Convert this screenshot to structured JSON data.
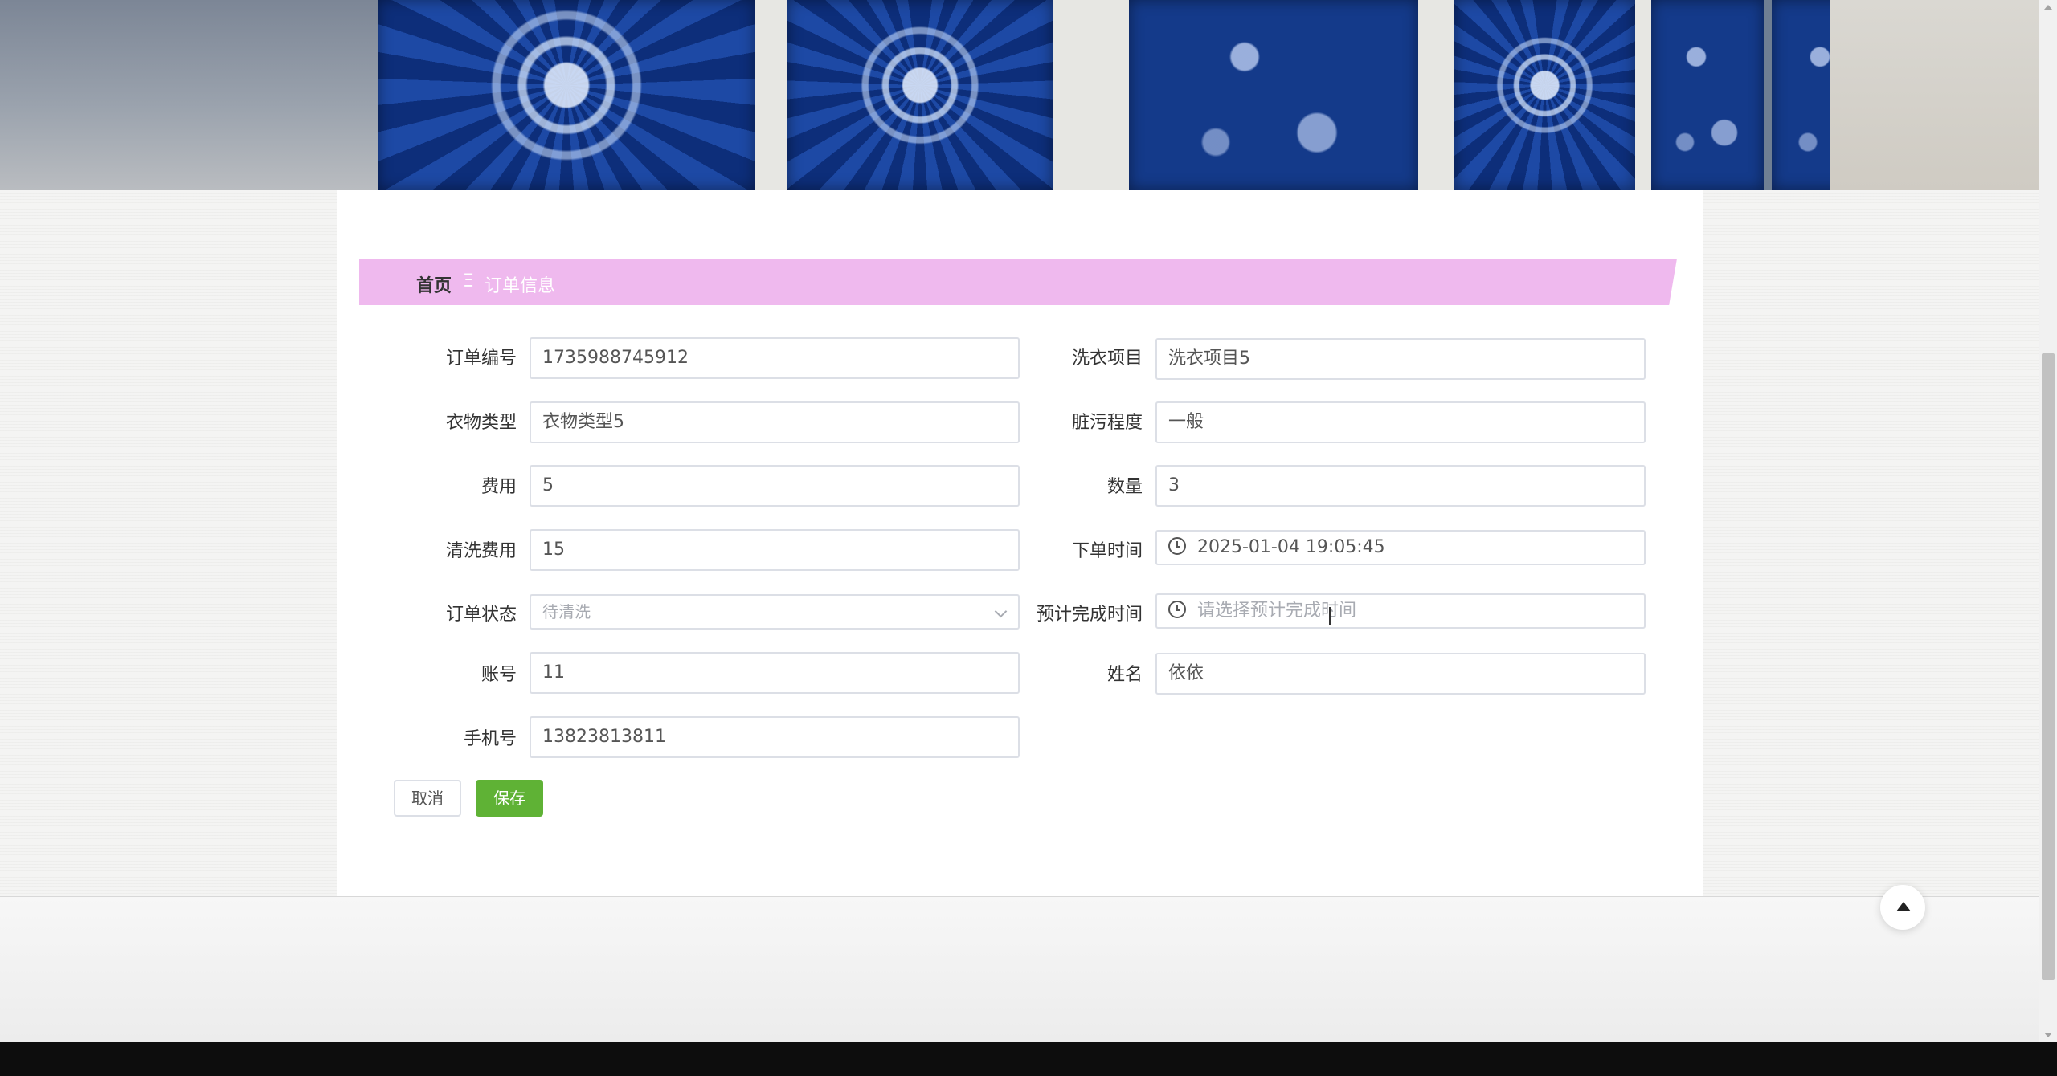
{
  "breadcrumb": {
    "home": "首页",
    "separator": "Ξ",
    "current": "订单信息"
  },
  "form": {
    "order_no": {
      "label": "订单编号",
      "value": "1735988745912"
    },
    "wash_item": {
      "label": "洗衣项目",
      "value": "洗衣项目5"
    },
    "clothes_type": {
      "label": "衣物类型",
      "value": "衣物类型5"
    },
    "dirty_level": {
      "label": "脏污程度",
      "value": "一般"
    },
    "fee": {
      "label": "费用",
      "value": "5"
    },
    "quantity": {
      "label": "数量",
      "value": "3"
    },
    "wash_fee": {
      "label": "清洗费用",
      "value": "15"
    },
    "order_time": {
      "label": "下单时间",
      "value": "2025-01-04 19:05:45"
    },
    "order_status": {
      "label": "订单状态",
      "value": "待清洗"
    },
    "expected_finish": {
      "label": "预计完成时间",
      "placeholder": "请选择预计完成时间"
    },
    "account": {
      "label": "账号",
      "value": "11"
    },
    "name": {
      "label": "姓名",
      "value": "依依"
    },
    "phone": {
      "label": "手机号",
      "value": "13823813811"
    }
  },
  "buttons": {
    "cancel": "取消",
    "save": "保存"
  },
  "colors": {
    "breadcrumb_bar": "#efb9ee",
    "save_button": "#5fb235"
  },
  "icons": {
    "time": "clock-icon",
    "select": "chevron-down-icon",
    "back_to_top": "arrow-up-icon"
  }
}
